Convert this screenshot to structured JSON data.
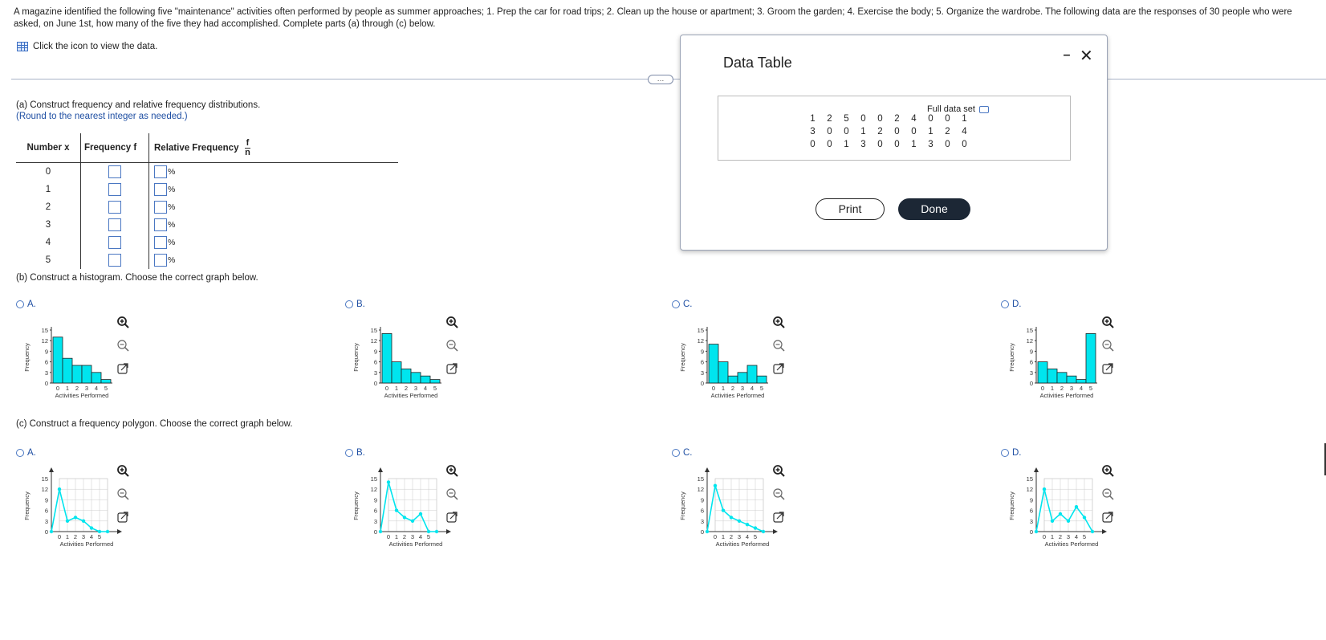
{
  "intro_text": "A magazine identified the following five \"maintenance\" activities often performed by people as summer approaches; 1. Prep the car for road trips; 2. Clean up the house or apartment; 3. Groom the garden; 4. Exercise the body; 5. Organize the wardrobe. The following data are the responses of 30 people who were asked, on June 1st, how many of the five they had accomplished. Complete parts (a) through (c) below.",
  "data_link": "Click the icon to view the data.",
  "more_label": "…",
  "part_a": {
    "title": "(a) Construct frequency and relative frequency distributions.",
    "hint": "(Round to the nearest integer as needed.)",
    "headers": {
      "x": "Number x",
      "f": "Frequency f",
      "rel": "Relative Frequency",
      "frac_num": "f",
      "frac_den": "n"
    },
    "rows": [
      "0",
      "1",
      "2",
      "3",
      "4",
      "5"
    ],
    "pct": "%"
  },
  "part_b": {
    "title": "(b) Construct a histogram. Choose the correct graph below."
  },
  "part_c": {
    "title": "(c) Construct a frequency polygon. Choose the correct graph below."
  },
  "options": [
    "A.",
    "B.",
    "C.",
    "D."
  ],
  "graph_labels": {
    "ylabel": "Frequency",
    "xlabel": "Activities Performed",
    "yticks": [
      "0",
      "3",
      "6",
      "9",
      "12",
      "15"
    ],
    "xticks": [
      "0",
      "1",
      "2",
      "3",
      "4",
      "5"
    ]
  },
  "modal": {
    "title": "Data Table",
    "full_set": "Full data set",
    "rows": [
      [
        "1",
        "2",
        "5",
        "0",
        "0",
        "2",
        "4",
        "0",
        "0",
        "1"
      ],
      [
        "3",
        "0",
        "0",
        "1",
        "2",
        "0",
        "0",
        "1",
        "2",
        "4"
      ],
      [
        "0",
        "0",
        "1",
        "3",
        "0",
        "0",
        "1",
        "3",
        "0",
        "0"
      ]
    ],
    "print": "Print",
    "done": "Done"
  },
  "colors": {
    "accent": "#1f4fa3",
    "bar": "#00e5ee",
    "done_bg": "#1c2735"
  },
  "chart_data": [
    {
      "type": "bar",
      "option": "A",
      "categories": [
        "0",
        "1",
        "2",
        "3",
        "4",
        "5"
      ],
      "values": [
        13,
        7,
        5,
        5,
        3,
        1
      ],
      "xlabel": "Activities Performed",
      "ylabel": "Frequency",
      "ylim": [
        0,
        15
      ]
    },
    {
      "type": "bar",
      "option": "B",
      "categories": [
        "0",
        "1",
        "2",
        "3",
        "4",
        "5"
      ],
      "values": [
        14,
        6,
        4,
        3,
        2,
        1
      ],
      "xlabel": "Activities Performed",
      "ylabel": "Frequency",
      "ylim": [
        0,
        15
      ]
    },
    {
      "type": "bar",
      "option": "C",
      "categories": [
        "0",
        "1",
        "2",
        "3",
        "4",
        "5"
      ],
      "values": [
        11,
        6,
        2,
        3,
        5,
        2
      ],
      "xlabel": "Activities Performed",
      "ylabel": "Frequency",
      "ylim": [
        0,
        15
      ]
    },
    {
      "type": "bar",
      "option": "D",
      "categories": [
        "0",
        "1",
        "2",
        "3",
        "4",
        "5"
      ],
      "values": [
        6,
        4,
        3,
        2,
        1,
        14
      ],
      "xlabel": "Activities Performed",
      "ylabel": "Frequency",
      "ylim": [
        0,
        15
      ]
    },
    {
      "type": "line",
      "option": "A",
      "x": [
        -1,
        0,
        1,
        2,
        3,
        4,
        5,
        6
      ],
      "values": [
        0,
        12,
        3,
        4,
        3,
        1,
        0,
        0
      ],
      "xlabel": "Activities Performed",
      "ylabel": "Frequency",
      "ylim": [
        0,
        15
      ]
    },
    {
      "type": "line",
      "option": "B",
      "x": [
        -1,
        0,
        1,
        2,
        3,
        4,
        5,
        6
      ],
      "values": [
        0,
        14,
        6,
        4,
        3,
        5,
        0,
        0
      ],
      "xlabel": "Activities Performed",
      "ylabel": "Frequency",
      "ylim": [
        0,
        15
      ]
    },
    {
      "type": "line",
      "option": "C",
      "x": [
        -1,
        0,
        1,
        2,
        3,
        4,
        5,
        6
      ],
      "values": [
        0,
        13,
        6,
        4,
        3,
        2,
        1,
        0
      ],
      "xlabel": "Activities Performed",
      "ylabel": "Frequency",
      "ylim": [
        0,
        15
      ]
    },
    {
      "type": "line",
      "option": "D",
      "x": [
        -1,
        0,
        1,
        2,
        3,
        4,
        5,
        6
      ],
      "values": [
        0,
        12,
        3,
        5,
        3,
        7,
        4,
        0
      ],
      "xlabel": "Activities Performed",
      "ylabel": "Frequency",
      "ylim": [
        0,
        15
      ]
    }
  ]
}
